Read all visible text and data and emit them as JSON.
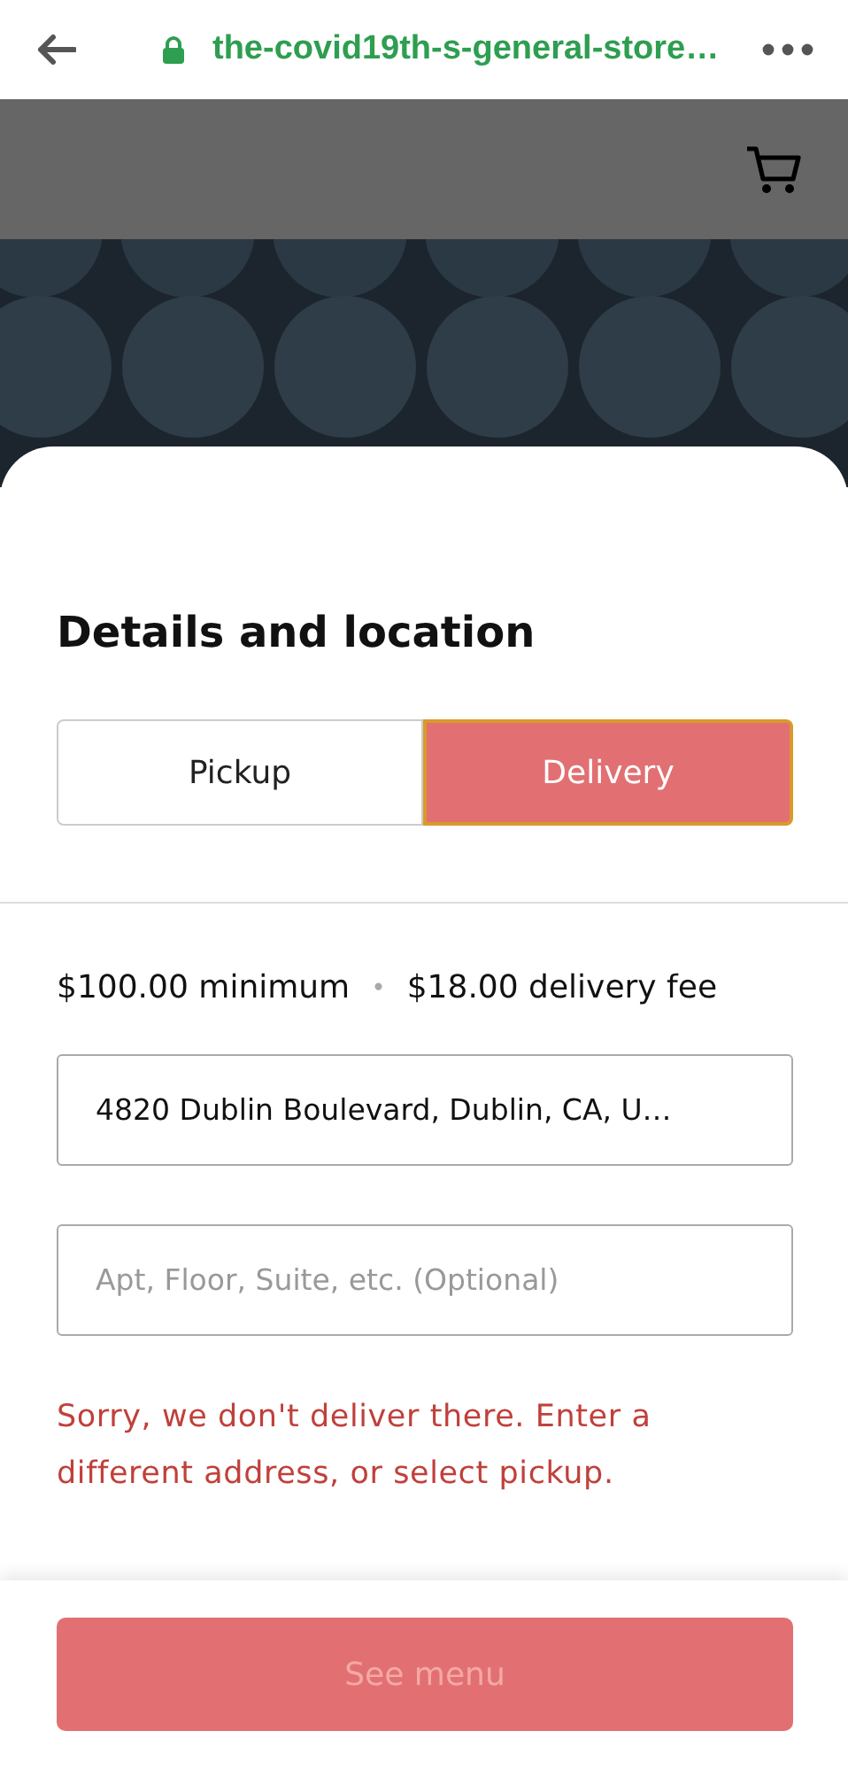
{
  "browser": {
    "url": "the-covid19th-s-general-store…"
  },
  "sheet": {
    "title": "Details and location",
    "fulfillment": [
      {
        "label": "Pickup",
        "selected": false
      },
      {
        "label": "Delivery",
        "selected": true
      }
    ],
    "minimum": "$100.00 minimum",
    "separator": "•",
    "fee": "$18.00 delivery fee",
    "address": {
      "value": "4820 Dublin Boulevard, Dublin, CA, U…"
    },
    "apt": {
      "placeholder": "Apt, Floor, Suite, etc. (Optional)"
    },
    "error": "Sorry, we don't deliver there. Enter a different address, or select pickup."
  },
  "footer": {
    "button": {
      "label": "See menu",
      "disabled": true
    }
  }
}
